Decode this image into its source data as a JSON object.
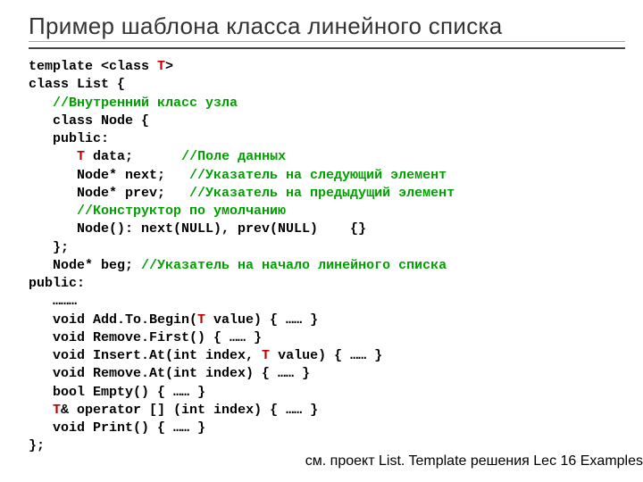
{
  "title": "Пример шаблона класса линейного списка",
  "code": {
    "l1a": "template <class ",
    "l1b": "T",
    "l1c": ">",
    "l2": "class List {",
    "l3": "   //Внутренний класс узла",
    "l4": "   class Node {",
    "l5": "   public:",
    "l6a": "      ",
    "l6b": "T",
    "l6c": " data;      ",
    "l6d": "//Поле данных",
    "l7a": "      Node* next;   ",
    "l7b": "//Указатель на следующий элемент",
    "l8a": "      Node* prev;   ",
    "l8b": "//Указатель на предыдущий элемент",
    "l9": "      //Конструктор по умолчанию",
    "l10": "      Node(): next(NULL), prev(NULL)    {}",
    "l11": "   };",
    "l12a": "   Node* beg; ",
    "l12b": "//Указатель на начало линейного списка",
    "l13": "public:",
    "l14": "   ………",
    "l15a": "   void Add.To.Begin(",
    "l15b": "T",
    "l15c": " value) { …… }",
    "l16": "   void Remove.First() { …… }",
    "l17a": "   void Insert.At(int index, ",
    "l17b": "T",
    "l17c": " value) { …… }",
    "l18": "   void Remove.At(int index) { …… }",
    "l19": "   bool Empty() { …… }",
    "l20a": "   ",
    "l20b": "T",
    "l20c": "& operator [] (int index) { …… }",
    "l21": "   void Print() { …… }",
    "l22": "};"
  },
  "footer": "см. проект List. Template решения Lec 16 Examples"
}
